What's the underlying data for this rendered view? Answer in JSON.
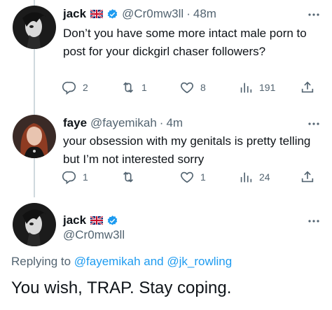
{
  "colors": {
    "accent": "#1d9bf0",
    "muted": "#536471",
    "text": "#0f1419",
    "line": "#cfd9de"
  },
  "tweets": [
    {
      "name": "jack",
      "handle": "@Cr0mw3ll",
      "dot": "·",
      "time": "48m",
      "text": "Don’t you have some more intact male porn to post for your dickgirl chaser followers?",
      "replies": "2",
      "retweets": "1",
      "likes": "8",
      "views": "191"
    },
    {
      "name": "faye",
      "handle": "@fayemikah",
      "dot": "·",
      "time": "4m",
      "text": "your obsession with my genitals is pretty telling but I’m not interested sorry",
      "replies": "1",
      "retweets": "",
      "likes": "1",
      "views": "24"
    }
  ],
  "main": {
    "name": "jack",
    "handle": "@Cr0mw3ll",
    "replying_prefix": "Replying to ",
    "mention1": "@fayemikah",
    "and": " and ",
    "mention2": "@jk_rowling",
    "text": "You wish, TRAP. Stay coping."
  },
  "icons": {
    "avatar1": "jack-avatar",
    "avatar2": "faye-avatar",
    "flag": "uk-flag-icon",
    "verified": "verified-badge-icon",
    "more": "more-icon",
    "reply": "reply-icon",
    "retweet": "retweet-icon",
    "like": "like-icon",
    "views": "views-icon",
    "share": "share-icon"
  }
}
